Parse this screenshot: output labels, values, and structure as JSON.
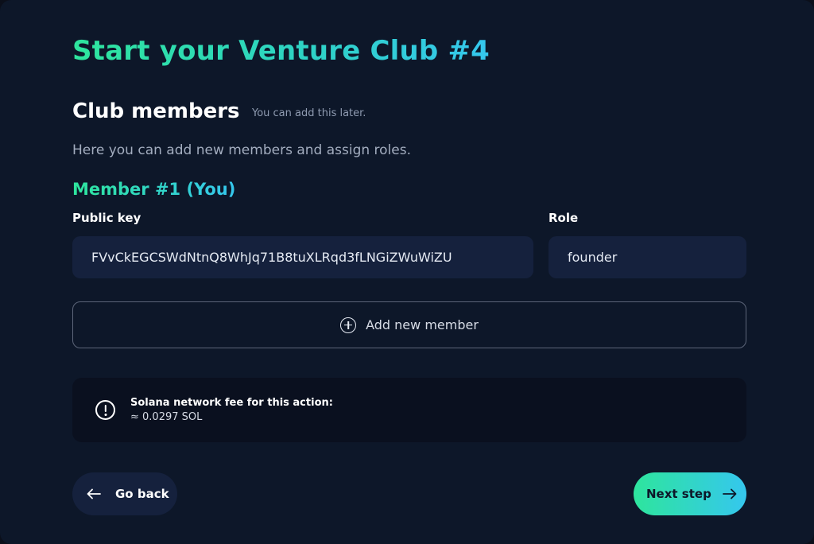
{
  "header": {
    "title": "Start your Venture Club #4"
  },
  "section": {
    "title": "Club members",
    "hint": "You can add this later.",
    "description": "Here you can add new members and assign roles."
  },
  "member": {
    "title": "Member #1 (You)",
    "public_key_label": "Public key",
    "public_key_value": "FVvCkEGCSWdNtnQ8WhJq71B8tuXLRqd3fLNGiZWuWiZU",
    "role_label": "Role",
    "role_value": "founder"
  },
  "add_member": {
    "label": "Add new member",
    "icon": "plus-circle-icon"
  },
  "fee": {
    "icon": "info-icon",
    "label": "Solana network fee for this action:",
    "value": "≈ 0.0297 SOL"
  },
  "navigation": {
    "back_label": "Go back",
    "next_label": "Next step"
  },
  "colors": {
    "background": "#0d1729",
    "field_background": "#15213d",
    "accent_start": "#2ee59d",
    "accent_end": "#35c7ee"
  }
}
